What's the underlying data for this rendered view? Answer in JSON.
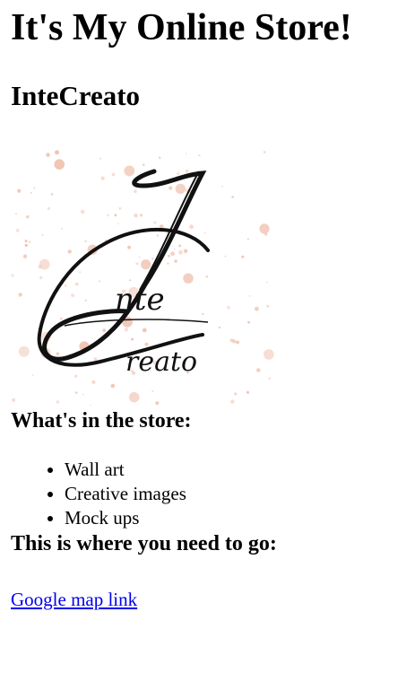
{
  "page": {
    "title": "It's My Online Store!",
    "store_name": "InteCreato"
  },
  "logo": {
    "name": "intecreato-logo",
    "text_line1": "nte",
    "text_line2": "reato",
    "splatter_color": "#f0c2b0"
  },
  "store_section": {
    "heading": "What's in the store:",
    "items": [
      "Wall art",
      "Creative images",
      "Mock ups"
    ]
  },
  "location_section": {
    "heading": "This is where you need to go:",
    "link_text": "Google map link"
  },
  "colors": {
    "link": "#0000ee",
    "text": "#000000"
  }
}
